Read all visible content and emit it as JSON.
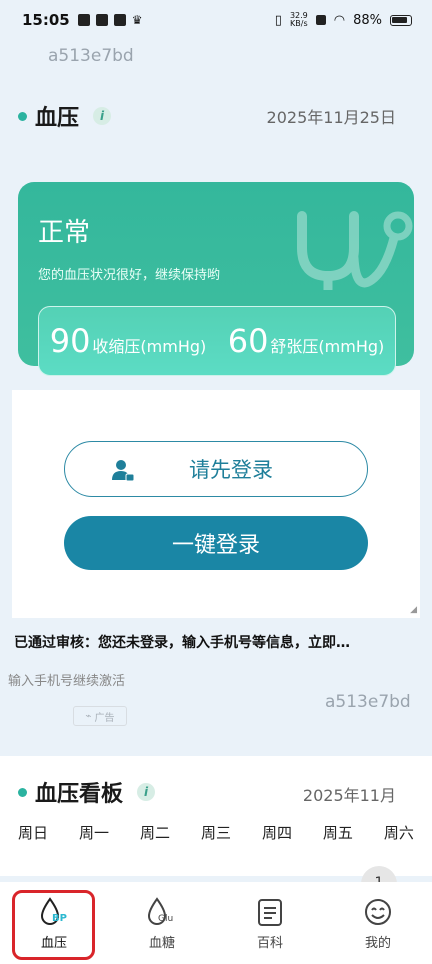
{
  "status_bar": {
    "time": "15:05",
    "net_speed_value": "32.9",
    "net_speed_unit": "KB/s",
    "battery": "88%"
  },
  "watermark": "a513e7bd",
  "bp_section": {
    "title": "血压",
    "info": "i",
    "date": "2025年11月25日"
  },
  "status_card": {
    "status": "正常",
    "description": "您的血压状况很好，继续保持哟",
    "systolic_value": "90",
    "systolic_label": "收缩压(mmHg)",
    "diastolic_value": "60",
    "diastolic_label": "舒张压(mmHg)"
  },
  "login": {
    "login_first": "请先登录",
    "one_click": "一键登录",
    "audit_text": "已通过审核：您还未登录，输入手机号等信息，立即…",
    "hint": "输入手机号继续激活",
    "ad_label": "广告"
  },
  "board": {
    "title": "血压看板",
    "info": "i",
    "month": "2025年11月",
    "weekdays": [
      "周日",
      "周一",
      "周二",
      "周三",
      "周四",
      "周五",
      "周六"
    ],
    "badge_count": "1"
  },
  "tabs": [
    {
      "label": "血压",
      "icon": "bp-drop-icon",
      "badge": "BP"
    },
    {
      "label": "血糖",
      "icon": "glucose-drop-icon",
      "badge": "Glu"
    },
    {
      "label": "百科",
      "icon": "clipboard-icon"
    },
    {
      "label": "我的",
      "icon": "smile-icon"
    }
  ],
  "colors": {
    "accent": "#2bb3a0",
    "card": "#3fbf9f",
    "button": "#1a86a5",
    "highlight": "#d9252a"
  }
}
